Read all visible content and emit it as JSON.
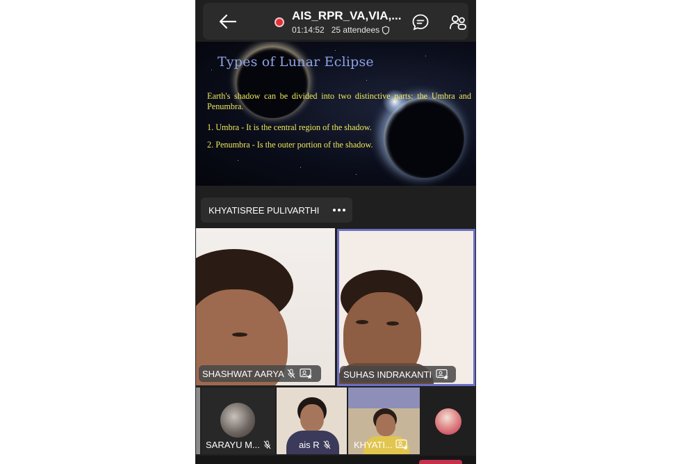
{
  "meeting": {
    "title": "AIS_RPR_VA,VIA,...",
    "duration": "01:14:52",
    "attendees": "25 attendees",
    "recording": true
  },
  "icons": {
    "back": "back-arrow-icon",
    "record": "recording-dot-icon",
    "shield": "shield-icon",
    "chat": "chat-icon",
    "participants": "participants-icon",
    "more": "more-options-icon",
    "mic_off": "mic-off-icon",
    "spotlight": "spotlight-video-icon"
  },
  "slide": {
    "title": "Types of Lunar Eclipse",
    "intro": "Earth's shadow can be divided into two distinctive parts: the Umbra and Penumbra.",
    "items": [
      "1.  Umbra -  It is the central region of the shadow.",
      "2.  Penumbra - Is the outer portion of the shadow."
    ]
  },
  "presenter": {
    "name": "KHYATISREE PULIVARTHI"
  },
  "video_tiles": [
    {
      "name": "SHASHWAT AARYA",
      "muted": true,
      "active_speaker": false
    },
    {
      "name": "SUHAS INDRAKANTI",
      "muted": false,
      "active_speaker": true
    }
  ],
  "strip": [
    {
      "name": "SARAYU M...",
      "muted": true
    },
    {
      "name": "ais R",
      "muted": true
    },
    {
      "name": "KHYATI...",
      "muted": false
    },
    {
      "name": "",
      "muted": false
    }
  ],
  "colors": {
    "background": "#1f1f1f",
    "record_red": "#e0303a",
    "active_border": "#6b6fc4",
    "slide_title": "#8fa3e6",
    "slide_text": "#f0e95a",
    "accent": "#c4314b"
  }
}
